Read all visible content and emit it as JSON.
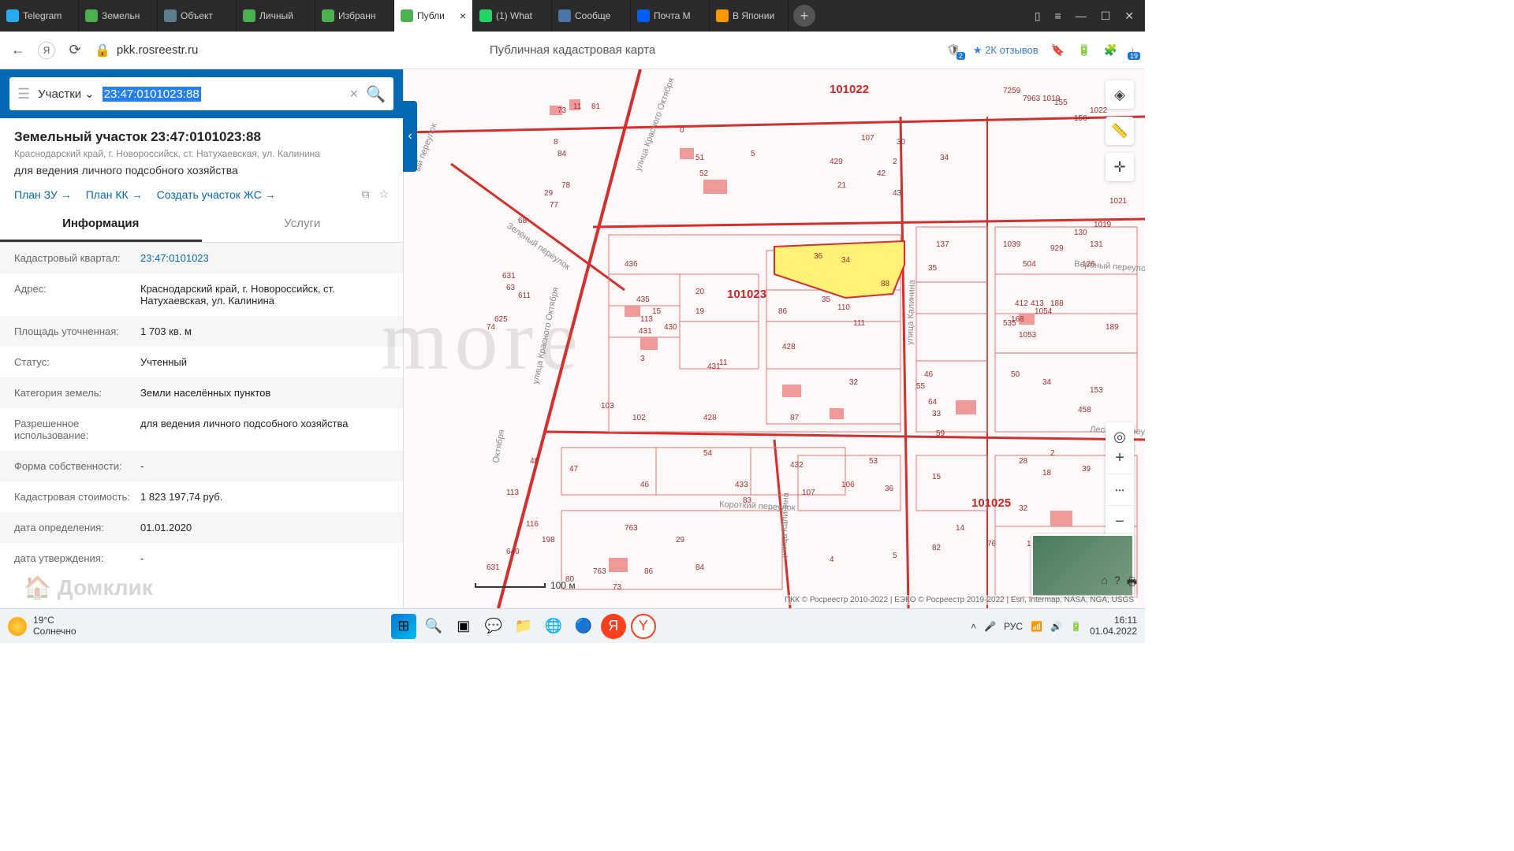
{
  "browser": {
    "tabs": [
      {
        "title": "Telegram",
        "color": "#2aabee"
      },
      {
        "title": "Земельн",
        "color": "#4caf50"
      },
      {
        "title": "Объект",
        "color": "#607d8b"
      },
      {
        "title": "Личный",
        "color": "#4caf50"
      },
      {
        "title": "Избранн",
        "color": "#4caf50"
      },
      {
        "title": "Публи",
        "color": "#4caf50",
        "active": true
      },
      {
        "title": "(1) What",
        "color": "#25d366"
      },
      {
        "title": "Сообще",
        "color": "#4a76a8"
      },
      {
        "title": "Почта M",
        "color": "#005ff9"
      },
      {
        "title": "В Японии",
        "color": "#ff9800"
      }
    ],
    "url": "pkk.rosreestr.ru",
    "page_title": "Публичная кадастровая карта",
    "notif_count": "2",
    "reviews": "★ 2К отзывов",
    "download_count": "19"
  },
  "search": {
    "type": "Участки",
    "value": "23:47:0101023:88"
  },
  "parcel": {
    "title": "Земельный участок 23:47:0101023:88",
    "address_short": "Краснодарский край, г. Новороссийск, ст. Натухаевская, ул. Калинина",
    "usage": "для ведения личного подсобного хозяйства",
    "links": {
      "plan_zu": "План ЗУ →",
      "plan_kk": "План КК →",
      "create": "Создать участок ЖС →"
    }
  },
  "tabs": {
    "info": "Информация",
    "services": "Услуги"
  },
  "info_rows": [
    {
      "key": "Кадастровый квартал:",
      "val": "23:47:0101023",
      "link": true
    },
    {
      "key": "Адрес:",
      "val": "Краснодарский край, г. Новороссийск, ст. Натухаевская, ул. Калинина"
    },
    {
      "key": "Площадь уточненная:",
      "val": "1 703 кв. м"
    },
    {
      "key": "Статус:",
      "val": "Учтенный"
    },
    {
      "key": "Категория земель:",
      "val": "Земли населённых пунктов"
    },
    {
      "key": "Разрешенное использование:",
      "val": "для ведения личного подсобного хозяйства"
    },
    {
      "key": "Форма собственности:",
      "val": "-"
    },
    {
      "key": "Кадастровая стоимость:",
      "val": "1 823 197,74 руб."
    },
    {
      "key": "дата определения:",
      "val": "01.01.2020"
    },
    {
      "key": "дата утверждения:",
      "val": "-"
    }
  ],
  "map": {
    "scale": "100 м",
    "attribution": "ПКК © Росреестр 2010-2022 | ЕЭКО © Росреестр 2019-2022 | Esri, Intermap, NASA, NGA, USGS",
    "blocks": [
      "101022",
      "101023",
      "101025"
    ],
    "streets": [
      "улица Красного Октября",
      "Зелёный переулок",
      "Короткий переулок",
      "улица Калинина",
      "Вербный переулок",
      "Лесной переулок"
    ],
    "highlighted_parcel": "88"
  },
  "watermarks": {
    "more": "more",
    "domclick": "Домклик"
  },
  "taskbar": {
    "weather_temp": "19°C",
    "weather_desc": "Солнечно",
    "lang": "РУС",
    "time": "16:11",
    "date": "01.04.2022"
  }
}
